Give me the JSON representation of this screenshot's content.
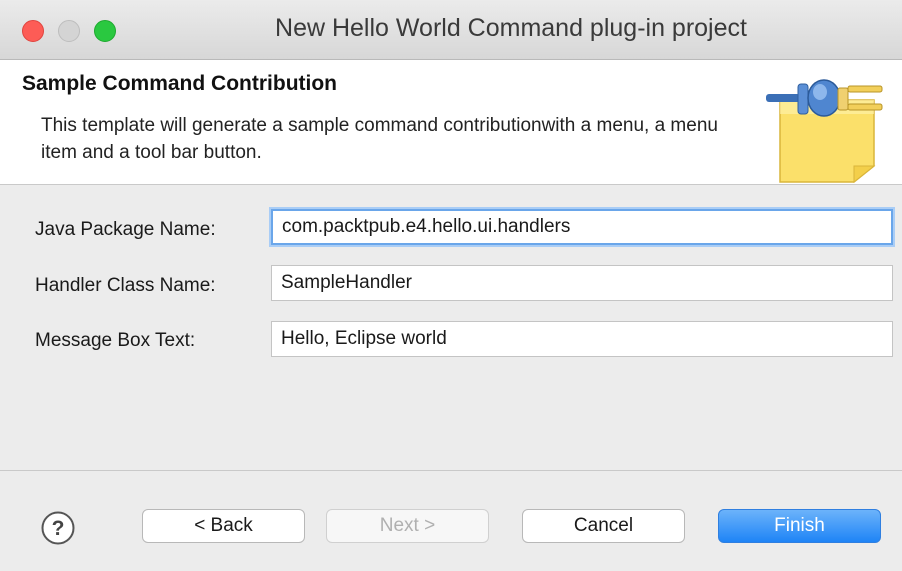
{
  "window": {
    "title": "New Hello World Command plug-in project"
  },
  "banner": {
    "heading": "Sample Command Contribution",
    "description": "This template will generate a sample command contributionwith a menu, a menu item and a tool bar button."
  },
  "form": {
    "package_label": "Java Package Name:",
    "package_value": "com.packtpub.e4.hello.ui.handlers",
    "handler_label": "Handler Class Name:",
    "handler_value": "SampleHandler",
    "message_label": "Message Box Text:",
    "message_value": "Hello, Eclipse world"
  },
  "footer": {
    "back_label": "< Back",
    "next_label": "Next >",
    "cancel_label": "Cancel",
    "finish_label": "Finish"
  },
  "icons": {
    "help": "help-icon",
    "banner_art": "plugin-icon"
  },
  "colors": {
    "finish_button": "#1e84f6",
    "focus_ring": "#6aa6ea",
    "close_light": "#fd5c56",
    "zoom_light": "#2ac840"
  }
}
